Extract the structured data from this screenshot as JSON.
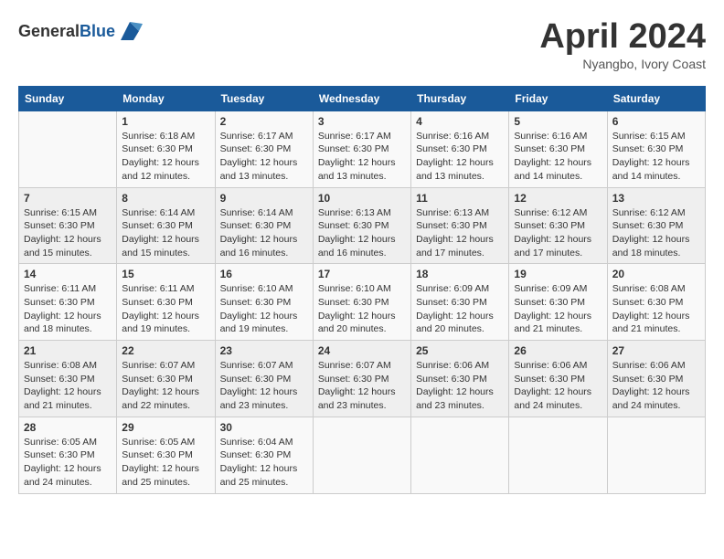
{
  "header": {
    "logo_general": "General",
    "logo_blue": "Blue",
    "month_title": "April 2024",
    "subtitle": "Nyangbo, Ivory Coast"
  },
  "weekdays": [
    "Sunday",
    "Monday",
    "Tuesday",
    "Wednesday",
    "Thursday",
    "Friday",
    "Saturday"
  ],
  "weeks": [
    [
      {
        "day": "",
        "info": ""
      },
      {
        "day": "1",
        "info": "Sunrise: 6:18 AM\nSunset: 6:30 PM\nDaylight: 12 hours\nand 12 minutes."
      },
      {
        "day": "2",
        "info": "Sunrise: 6:17 AM\nSunset: 6:30 PM\nDaylight: 12 hours\nand 13 minutes."
      },
      {
        "day": "3",
        "info": "Sunrise: 6:17 AM\nSunset: 6:30 PM\nDaylight: 12 hours\nand 13 minutes."
      },
      {
        "day": "4",
        "info": "Sunrise: 6:16 AM\nSunset: 6:30 PM\nDaylight: 12 hours\nand 13 minutes."
      },
      {
        "day": "5",
        "info": "Sunrise: 6:16 AM\nSunset: 6:30 PM\nDaylight: 12 hours\nand 14 minutes."
      },
      {
        "day": "6",
        "info": "Sunrise: 6:15 AM\nSunset: 6:30 PM\nDaylight: 12 hours\nand 14 minutes."
      }
    ],
    [
      {
        "day": "7",
        "info": "Sunrise: 6:15 AM\nSunset: 6:30 PM\nDaylight: 12 hours\nand 15 minutes."
      },
      {
        "day": "8",
        "info": "Sunrise: 6:14 AM\nSunset: 6:30 PM\nDaylight: 12 hours\nand 15 minutes."
      },
      {
        "day": "9",
        "info": "Sunrise: 6:14 AM\nSunset: 6:30 PM\nDaylight: 12 hours\nand 16 minutes."
      },
      {
        "day": "10",
        "info": "Sunrise: 6:13 AM\nSunset: 6:30 PM\nDaylight: 12 hours\nand 16 minutes."
      },
      {
        "day": "11",
        "info": "Sunrise: 6:13 AM\nSunset: 6:30 PM\nDaylight: 12 hours\nand 17 minutes."
      },
      {
        "day": "12",
        "info": "Sunrise: 6:12 AM\nSunset: 6:30 PM\nDaylight: 12 hours\nand 17 minutes."
      },
      {
        "day": "13",
        "info": "Sunrise: 6:12 AM\nSunset: 6:30 PM\nDaylight: 12 hours\nand 18 minutes."
      }
    ],
    [
      {
        "day": "14",
        "info": "Sunrise: 6:11 AM\nSunset: 6:30 PM\nDaylight: 12 hours\nand 18 minutes."
      },
      {
        "day": "15",
        "info": "Sunrise: 6:11 AM\nSunset: 6:30 PM\nDaylight: 12 hours\nand 19 minutes."
      },
      {
        "day": "16",
        "info": "Sunrise: 6:10 AM\nSunset: 6:30 PM\nDaylight: 12 hours\nand 19 minutes."
      },
      {
        "day": "17",
        "info": "Sunrise: 6:10 AM\nSunset: 6:30 PM\nDaylight: 12 hours\nand 20 minutes."
      },
      {
        "day": "18",
        "info": "Sunrise: 6:09 AM\nSunset: 6:30 PM\nDaylight: 12 hours\nand 20 minutes."
      },
      {
        "day": "19",
        "info": "Sunrise: 6:09 AM\nSunset: 6:30 PM\nDaylight: 12 hours\nand 21 minutes."
      },
      {
        "day": "20",
        "info": "Sunrise: 6:08 AM\nSunset: 6:30 PM\nDaylight: 12 hours\nand 21 minutes."
      }
    ],
    [
      {
        "day": "21",
        "info": "Sunrise: 6:08 AM\nSunset: 6:30 PM\nDaylight: 12 hours\nand 21 minutes."
      },
      {
        "day": "22",
        "info": "Sunrise: 6:07 AM\nSunset: 6:30 PM\nDaylight: 12 hours\nand 22 minutes."
      },
      {
        "day": "23",
        "info": "Sunrise: 6:07 AM\nSunset: 6:30 PM\nDaylight: 12 hours\nand 23 minutes."
      },
      {
        "day": "24",
        "info": "Sunrise: 6:07 AM\nSunset: 6:30 PM\nDaylight: 12 hours\nand 23 minutes."
      },
      {
        "day": "25",
        "info": "Sunrise: 6:06 AM\nSunset: 6:30 PM\nDaylight: 12 hours\nand 23 minutes."
      },
      {
        "day": "26",
        "info": "Sunrise: 6:06 AM\nSunset: 6:30 PM\nDaylight: 12 hours\nand 24 minutes."
      },
      {
        "day": "27",
        "info": "Sunrise: 6:06 AM\nSunset: 6:30 PM\nDaylight: 12 hours\nand 24 minutes."
      }
    ],
    [
      {
        "day": "28",
        "info": "Sunrise: 6:05 AM\nSunset: 6:30 PM\nDaylight: 12 hours\nand 24 minutes."
      },
      {
        "day": "29",
        "info": "Sunrise: 6:05 AM\nSunset: 6:30 PM\nDaylight: 12 hours\nand 25 minutes."
      },
      {
        "day": "30",
        "info": "Sunrise: 6:04 AM\nSunset: 6:30 PM\nDaylight: 12 hours\nand 25 minutes."
      },
      {
        "day": "",
        "info": ""
      },
      {
        "day": "",
        "info": ""
      },
      {
        "day": "",
        "info": ""
      },
      {
        "day": "",
        "info": ""
      }
    ]
  ]
}
